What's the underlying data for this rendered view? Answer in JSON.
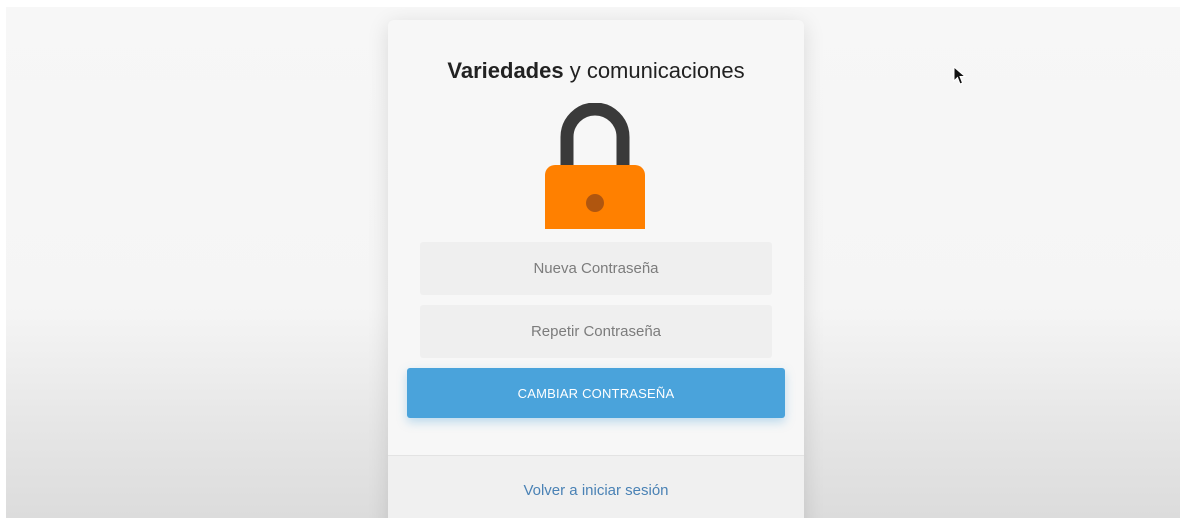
{
  "header": {
    "brand": "Variedades",
    "rest": " y comunicaciones"
  },
  "lock": {
    "icon": "lock-icon",
    "body_color": "#FF8000",
    "shackle_color": "#3A3A3A",
    "keyhole_color": "#B0560F"
  },
  "form": {
    "new_password_placeholder": "Nueva Contraseña",
    "repeat_password_placeholder": "Repetir Contraseña",
    "submit_label": "CAMBIAR CONTRASEÑA",
    "accent_color": "#4AA3DB"
  },
  "footer": {
    "back_link": "Volver a iniciar sesión",
    "link_color": "#4A82B5"
  }
}
